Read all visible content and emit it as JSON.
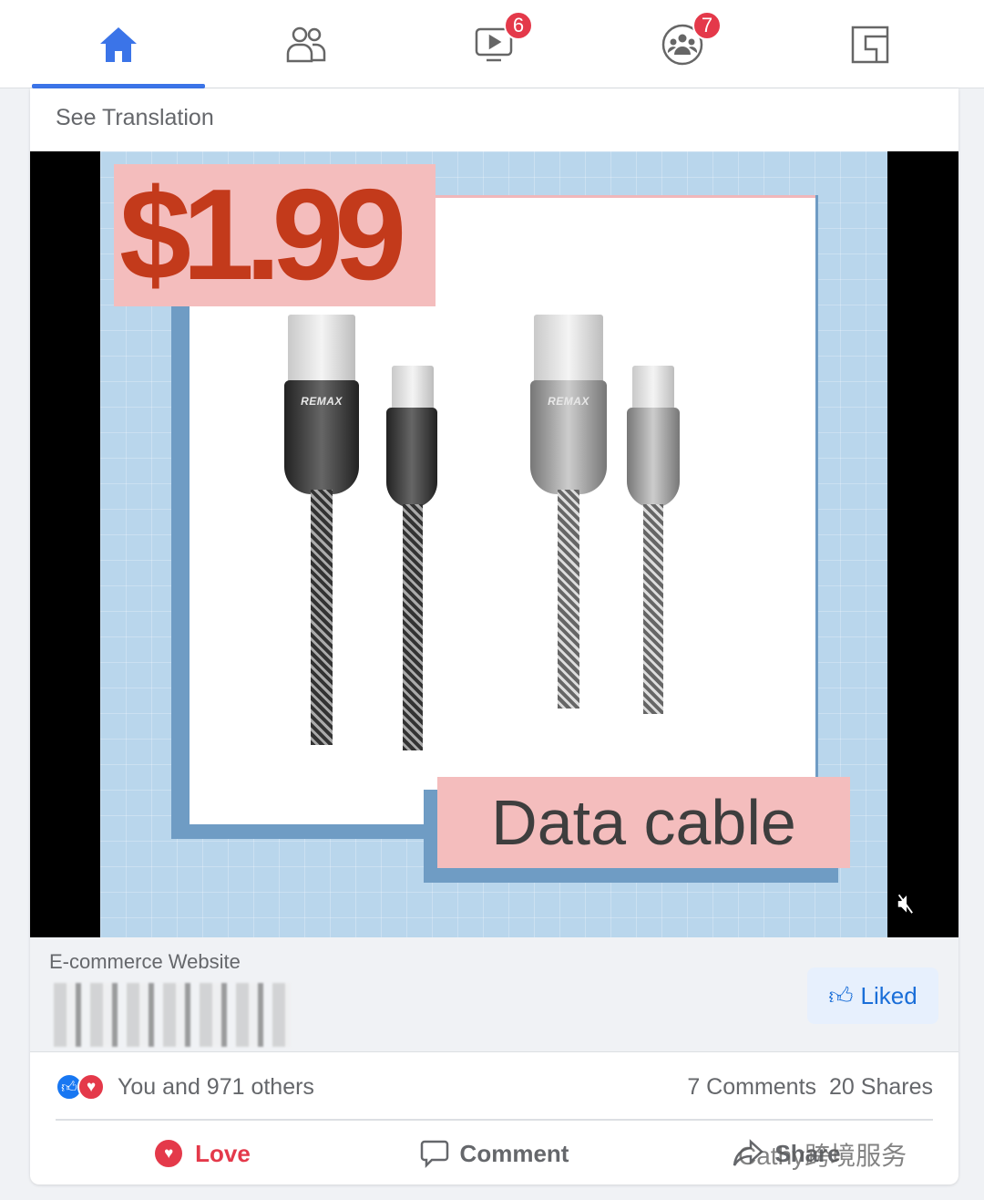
{
  "nav": {
    "tabs": [
      {
        "name": "home",
        "active": true
      },
      {
        "name": "friends"
      },
      {
        "name": "watch",
        "badge": "6"
      },
      {
        "name": "groups",
        "badge": "7"
      },
      {
        "name": "pages"
      }
    ]
  },
  "post": {
    "see_translation": "See Translation",
    "media": {
      "price": "$1.99",
      "caption": "Data cable",
      "brand": "REMAX",
      "muted": true
    },
    "page_name": "E-commerce Website",
    "liked_label": "Liked",
    "reactions_text": "You and 971 others",
    "comments": "7 Comments",
    "shares": "20 Shares",
    "actions": {
      "love": "Love",
      "comment": "Comment",
      "share": "Share"
    }
  },
  "watermark": "Cathy跨境服务",
  "colors": {
    "accent": "#3b74e8",
    "badge": "#e4394a",
    "love": "#e4394a",
    "price": "#c33a1b"
  }
}
